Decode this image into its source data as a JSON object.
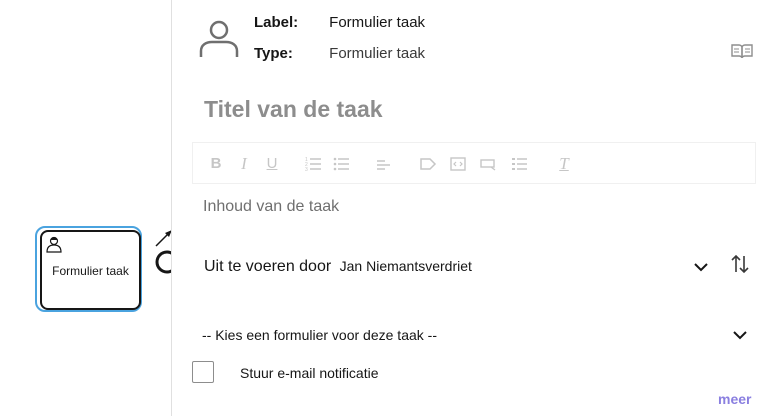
{
  "diagram": {
    "task_label": "Formulier taak"
  },
  "header": {
    "label_key": "Label:",
    "label_value": "Formulier taak",
    "type_key": "Type:",
    "type_value": "Formulier taak"
  },
  "editor": {
    "title_placeholder": "Titel van de taak",
    "content_placeholder": "Inhoud van de taak",
    "toolbar": {
      "bold": "B",
      "italic": "I",
      "underline": "U",
      "clear_format": "T"
    }
  },
  "assignee": {
    "label": "Uit te voeren door",
    "value": "Jan Niemantsverdriet"
  },
  "form_select": {
    "placeholder": "-- Kies een formulier voor deze taak --"
  },
  "notification": {
    "label": "Stuur e-mail notificatie"
  },
  "more_link": "meer",
  "colors": {
    "selection": "#4aa3df",
    "link": "#8a7fe0",
    "placeholder": "#8d8d8d"
  }
}
